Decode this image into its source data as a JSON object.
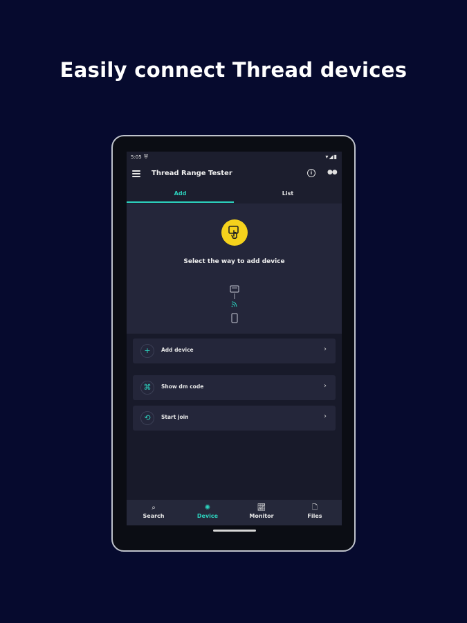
{
  "headline": "Easily connect Thread devices",
  "status_bar": {
    "time": "5:05"
  },
  "app_bar": {
    "title": "Thread Range Tester"
  },
  "tabs": [
    {
      "label": "Add",
      "selected": true
    },
    {
      "label": "List",
      "selected": false
    }
  ],
  "hero": {
    "badge_icon": "touch-app-icon",
    "title": "Select the way to add device"
  },
  "actions": [
    {
      "label": "Add device",
      "icon": "plus-icon"
    },
    {
      "label": "Show dm code",
      "icon": "qr-code-icon"
    },
    {
      "label": "Start join",
      "icon": "history-icon"
    }
  ],
  "bottom_nav": [
    {
      "label": "Search",
      "icon": "search-icon",
      "active": false
    },
    {
      "label": "Device",
      "icon": "device-icon",
      "active": true
    },
    {
      "label": "Monitor",
      "icon": "chart-icon",
      "active": false
    },
    {
      "label": "Files",
      "icon": "file-icon",
      "active": false
    }
  ],
  "colors": {
    "accent": "#2dd4bf",
    "badge": "#f5d21c",
    "background": "#060a2e",
    "surface": "#24263a"
  }
}
